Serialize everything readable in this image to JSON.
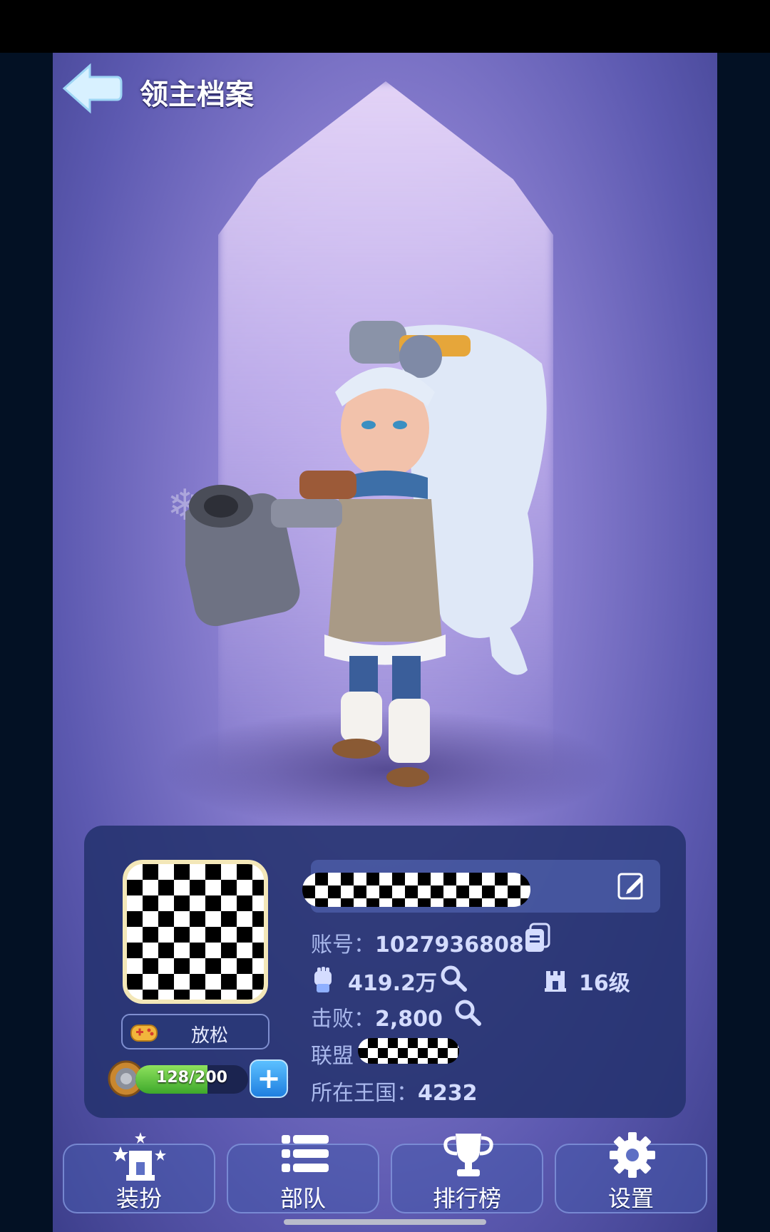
{
  "header": {
    "title": "领主档案"
  },
  "profile": {
    "status_label": "放松",
    "stamina": {
      "text": "128/200",
      "current": 128,
      "max": 200
    },
    "account": {
      "label": "账号：",
      "value": "1027936808"
    },
    "power": {
      "value": "419.2万"
    },
    "level": {
      "value": "16级"
    },
    "defeat": {
      "label": "击败：",
      "value": "2,800"
    },
    "alliance": {
      "label": "联盟"
    },
    "kingdom": {
      "label": "所在王国：",
      "value": "4232"
    }
  },
  "nav": [
    {
      "label": "装扮",
      "icon": "castle-star-icon"
    },
    {
      "label": "部队",
      "icon": "list-icon"
    },
    {
      "label": "排行榜",
      "icon": "trophy-icon"
    },
    {
      "label": "设置",
      "icon": "gear-icon"
    }
  ],
  "colors": {
    "accent": "#1f7fe0",
    "stamina": "#3ea82b",
    "panel": "#24326e"
  }
}
